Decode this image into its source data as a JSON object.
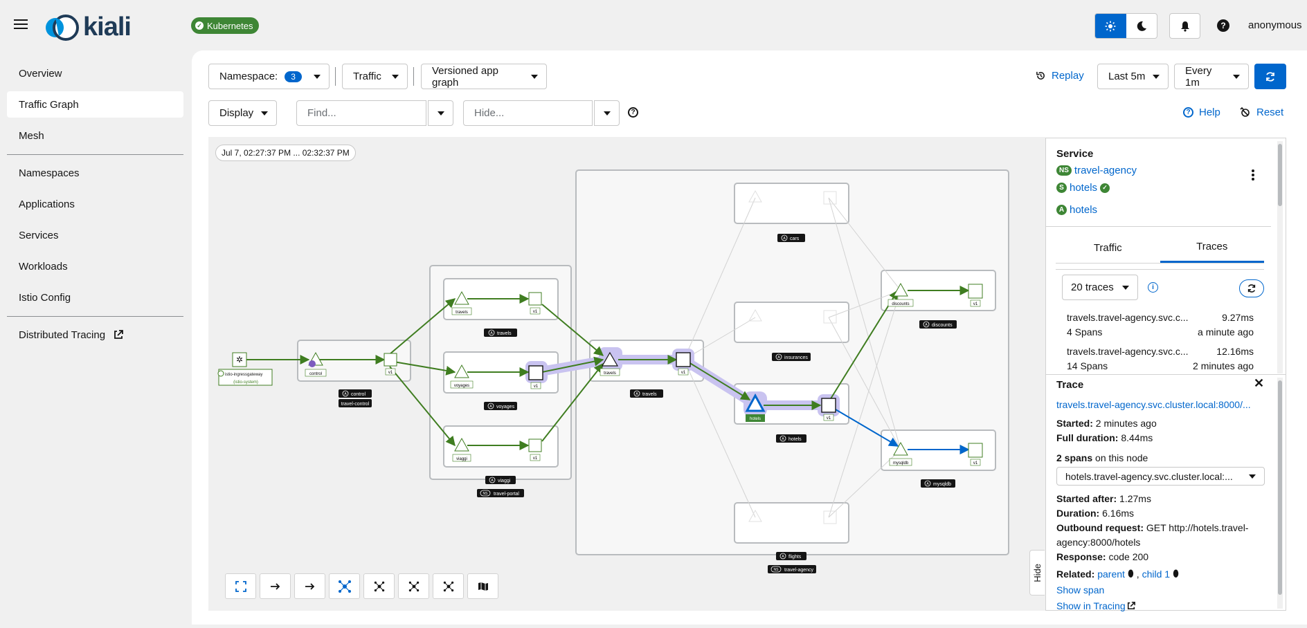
{
  "app": {
    "name": "kiali",
    "cluster_badge": "Kubernetes",
    "user": "anonymous"
  },
  "sidebar": {
    "items": [
      {
        "label": "Overview"
      },
      {
        "label": "Traffic Graph"
      },
      {
        "label": "Mesh"
      },
      {
        "label": "Namespaces"
      },
      {
        "label": "Applications"
      },
      {
        "label": "Services"
      },
      {
        "label": "Workloads"
      },
      {
        "label": "Istio Config"
      },
      {
        "label": "Distributed Tracing"
      }
    ]
  },
  "toolbar": {
    "namespace_label": "Namespace:",
    "namespace_count": "3",
    "traffic_label": "Traffic",
    "graph_type": "Versioned app graph",
    "replay": "Replay",
    "duration": "Last 5m",
    "refresh_interval": "Every 1m",
    "display_label": "Display",
    "find_placeholder": "Find...",
    "hide_placeholder": "Hide...",
    "help": "Help",
    "reset": "Reset"
  },
  "graph": {
    "time_range": "Jul 7, 02:27:37 PM ... 02:32:37 PM",
    "nodes": {
      "gateway": "istio-ingressgateway",
      "gateway_sub": "(istio-system)",
      "control": "control",
      "travels": "travels",
      "voyages": "voyages",
      "viaggi": "viaggi",
      "v1": "v1",
      "hotels": "hotels",
      "discounts": "discounts",
      "mysqldb": "mysqldb"
    },
    "boxes": {
      "control": "control",
      "travel_control": "travel-control",
      "travels_portal": "travels",
      "voyages": "voyages",
      "viaggi": "viaggi",
      "travel_portal": "travel-portal",
      "travels": "travels",
      "cars": "cars",
      "insurances": "insurances",
      "hotels": "hotels",
      "flights": "flights",
      "travel_agency": "travel-agency",
      "discounts": "discounts",
      "mysqldb": "mysqldb",
      "app_badge": "A",
      "ns_badge": "NS"
    },
    "hide_tab": "Hide"
  },
  "panel": {
    "service_heading": "Service",
    "ns_badge": "NS",
    "namespace": "travel-agency",
    "svc_badge": "S",
    "service": "hotels",
    "app_badge": "A",
    "app": "hotels",
    "tabs": [
      "Traffic",
      "Traces"
    ],
    "trace_count": "20 traces",
    "traces": [
      {
        "name": "travels.travel-agency.svc.c...",
        "duration": "9.27ms",
        "spans": "4 Spans",
        "ago": "a minute ago"
      },
      {
        "name": "travels.travel-agency.svc.c...",
        "duration": "12.16ms",
        "spans": "14 Spans",
        "ago": "2 minutes ago"
      }
    ],
    "trace_heading": "Trace",
    "trace_link": "travels.travel-agency.svc.cluster.local:8000/...",
    "started_label": "Started:",
    "started": "2 minutes ago",
    "full_duration_label": "Full duration:",
    "full_duration": "8.44ms",
    "spans_count": "2 spans",
    "spans_suffix": "on this node",
    "span_select": "hotels.travel-agency.svc.cluster.local:...",
    "started_after_label": "Started after:",
    "started_after": "1.27ms",
    "duration_label": "Duration:",
    "duration": "6.16ms",
    "outbound_label": "Outbound request:",
    "outbound_line1": "GET http://hotels.travel-",
    "outbound_line2": "agency:8000/hotels",
    "response_label": "Response:",
    "response": "code 200",
    "related_label": "Related:",
    "related_parent": "parent",
    "related_sep": ", ",
    "related_child": "child 1",
    "show_span": "Show span",
    "show_tracing": "Show in Tracing"
  },
  "colors": {
    "accent": "#0066cc",
    "success": "#3e8635",
    "edge": "#3f7d20",
    "highlight": "#c9c3f0"
  }
}
